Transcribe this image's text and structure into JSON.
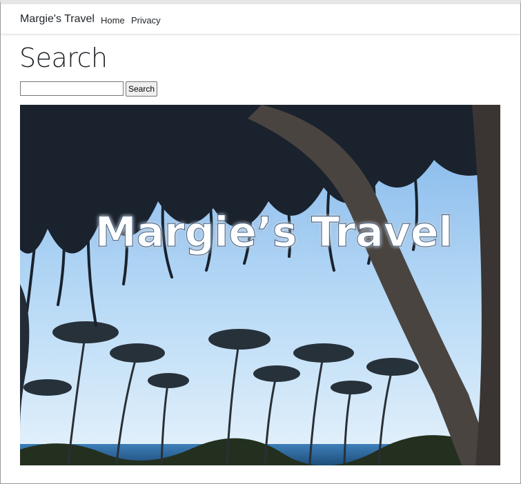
{
  "navbar": {
    "brand": "Margie's Travel",
    "links": [
      {
        "label": "Home"
      },
      {
        "label": "Privacy"
      }
    ]
  },
  "main": {
    "title": "Search",
    "search": {
      "value": "",
      "placeholder": "",
      "button_label": "Search"
    },
    "hero": {
      "overlay_text": "Margie’s Travel",
      "description": "palm-trees-beach-photo"
    }
  },
  "colors": {
    "text": "#212529",
    "sky": "#9ecbf2",
    "ocean": "#2f6fa8",
    "foliage": "#1c2430"
  }
}
